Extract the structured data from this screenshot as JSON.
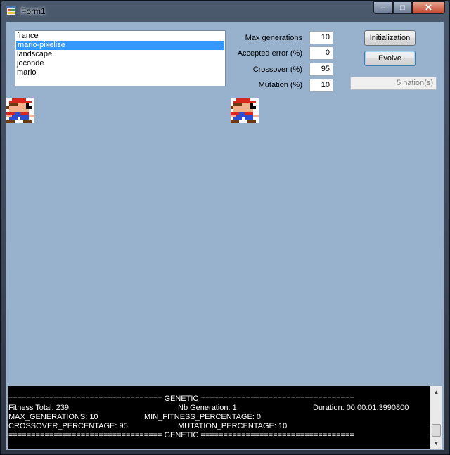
{
  "window": {
    "title": "Form1",
    "minimize_glyph": "–",
    "maximize_glyph": "□",
    "close_glyph": "✕"
  },
  "images_list": {
    "items": [
      "france",
      "mario-pixelise",
      "landscape",
      "joconde",
      "mario"
    ],
    "selected": "mario-pixelise"
  },
  "params": {
    "max_generations": {
      "label": "Max generations",
      "value": "10"
    },
    "accepted_error": {
      "label": "Accepted error (%)",
      "value": "0"
    },
    "crossover": {
      "label": "Crossover (%)",
      "value": "95"
    },
    "mutation": {
      "label": "Mutation (%)",
      "value": "10"
    }
  },
  "buttons": {
    "initialization": "Initialization",
    "evolve": "Evolve"
  },
  "status": {
    "nations": "5 nation(s)"
  },
  "images": {
    "source_icon": "mario-sprite-icon",
    "evolved_icon": "mario-sprite-icon"
  },
  "console": {
    "line1": "================================== GENETIC ==================================",
    "fitness_total": "Fitness Total: 239",
    "nb_generation": "Nb Generation: 1",
    "duration": "Duration: 00:00:01.3990800",
    "max_generations": "MAX_GENERATIONS: 10",
    "min_fitness": "MIN_FITNESS_PERCENTAGE: 0",
    "crossover": "CROSSOVER_PERCENTAGE: 95",
    "mutation": "MUTATION_PERCENTAGE: 10",
    "line_last": "================================== GENETIC =================================="
  },
  "colors": {
    "client_bg": "#98b1cd",
    "selection": "#3399ff",
    "console_bg": "#000000"
  }
}
